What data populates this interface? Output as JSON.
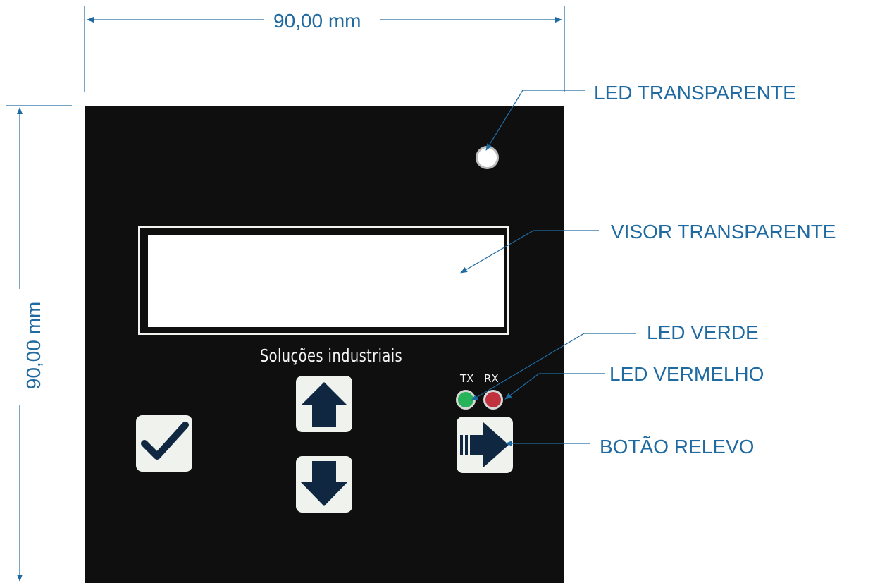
{
  "dimensions": {
    "width_label": "90,00 mm",
    "height_label": "90,00 mm"
  },
  "panel": {
    "brand_text": "Soluções industriais",
    "led_tx_label": "TX",
    "led_rx_label": "RX"
  },
  "callouts": {
    "led_transparente": "LED TRANSPARENTE",
    "visor_transparente": "VISOR TRANSPARENTE",
    "led_verde": "LED VERDE",
    "led_vermelho": "LED VERMELHO",
    "botao_relevo": "BOTÃO RELEVO"
  },
  "colors": {
    "annotation": "#1f6aa0",
    "panel": "#0f0f0f",
    "button_face": "#f0f2ee",
    "button_icon": "#0f2740",
    "led_green": "#27b35a",
    "led_red": "#c1323f"
  },
  "icons": {
    "confirm": "check-icon",
    "up": "arrow-up-icon",
    "down": "arrow-down-icon",
    "right": "arrow-right-icon"
  }
}
